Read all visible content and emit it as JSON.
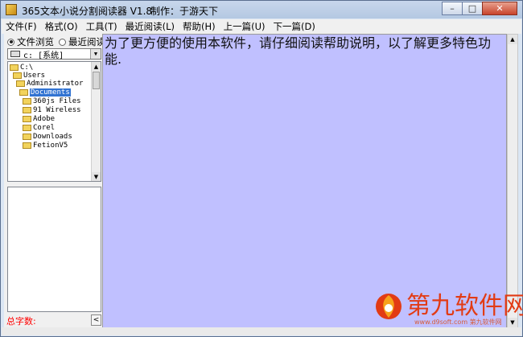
{
  "window": {
    "title": "365文本小说分割阅读器 V1.8",
    "author": "制作：于游天下",
    "controls": {
      "minimize": "–",
      "maximize": "□",
      "close": "✕"
    }
  },
  "menu": [
    "文件(F)",
    "格式(O)",
    "工具(T)",
    "最近阅读(L)",
    "帮助(H)",
    "上一篇(U)",
    "下一篇(D)"
  ],
  "left_panel": {
    "radio_file_browse": "文件浏览",
    "radio_recent_read": "最近阅读",
    "drive": "c: [系统]",
    "tree": [
      {
        "label": "C:\\",
        "depth": 0,
        "selected": false
      },
      {
        "label": "Users",
        "depth": 1,
        "selected": false
      },
      {
        "label": "Administrator",
        "depth": 2,
        "selected": false
      },
      {
        "label": "Documents",
        "depth": 3,
        "selected": true
      },
      {
        "label": "360js Files",
        "depth": 4,
        "selected": false
      },
      {
        "label": "91 Wireless",
        "depth": 4,
        "selected": false
      },
      {
        "label": "Adobe",
        "depth": 4,
        "selected": false
      },
      {
        "label": "Corel",
        "depth": 4,
        "selected": false
      },
      {
        "label": "Downloads",
        "depth": 4,
        "selected": false
      },
      {
        "label": "FetionV5",
        "depth": 4,
        "selected": false
      }
    ],
    "word_count_label": "总字数:",
    "collapse_glyph": "<"
  },
  "reader": {
    "text": "为了更方便的使用本软件，请仔细阅读帮助说明，以了解更多特色功能."
  },
  "watermark": {
    "text": "第九软件网",
    "url": "www.d9soft.com 第九软件网"
  },
  "colors": {
    "reader_background": "#c0c0ff",
    "selection": "#3173d2",
    "word_count": "#ff0000",
    "watermark": "#e23b14"
  },
  "icons": [
    "app-icon",
    "drive-icon",
    "folder-icon",
    "chevron-down-icon",
    "arrow-up-icon",
    "arrow-down-icon",
    "chevron-left-icon"
  ]
}
